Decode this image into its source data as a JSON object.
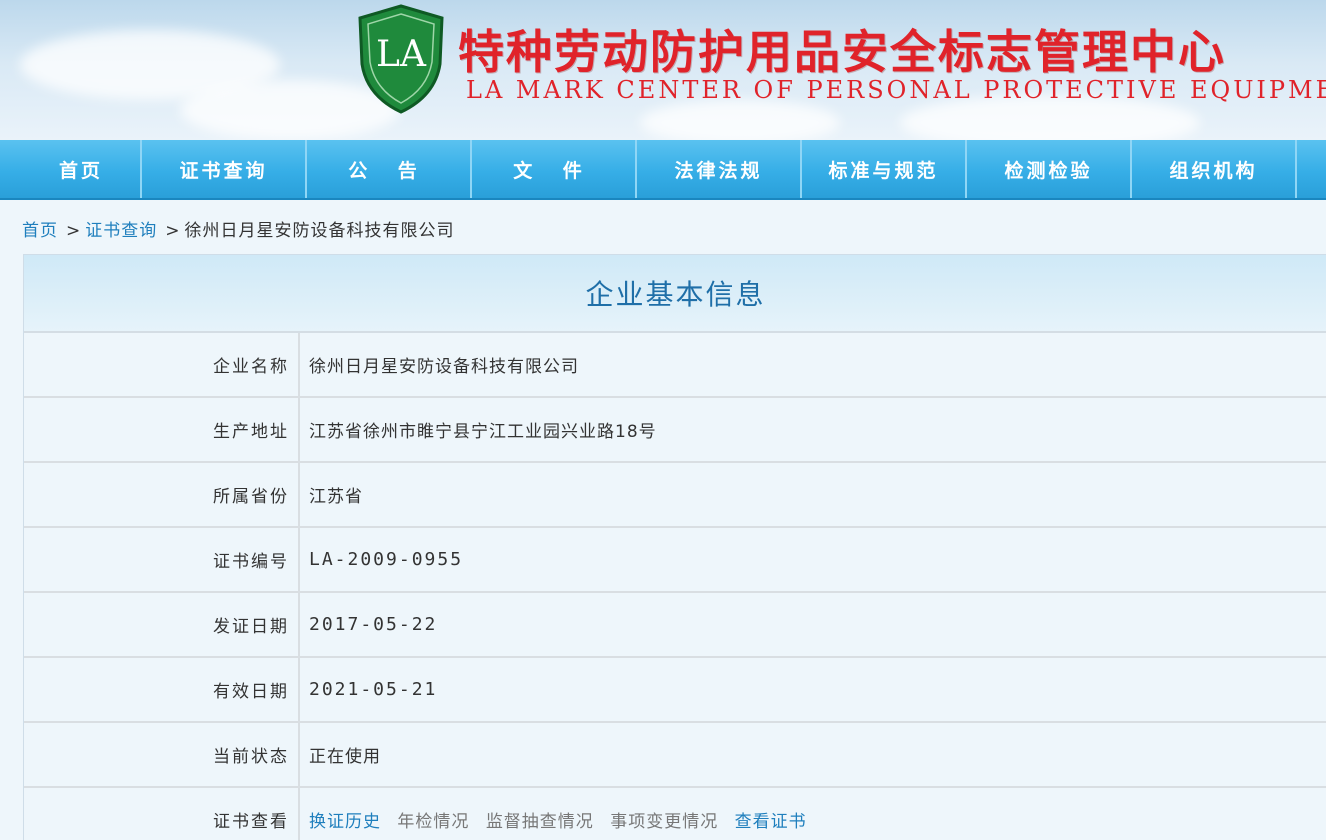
{
  "header": {
    "logo_text": "LA",
    "title_cn": "特种劳动防护用品安全标志管理中心",
    "title_en": "LA MARK CENTER OF PERSONAL PROTECTIVE EQUIPMENT",
    "shield_color": "#1f8a3c",
    "title_color": "#e0232a"
  },
  "nav": {
    "items": [
      "首页",
      "证书查询",
      "公 告",
      "文 件",
      "法律法规",
      "标准与规范",
      "检测检验",
      "组织机构"
    ]
  },
  "breadcrumb": {
    "home": "首页",
    "sep1": ">",
    "cert_query": "证书查询",
    "sep2": ">",
    "current": "徐州日月星安防设备科技有限公司"
  },
  "panel": {
    "title": "企业基本信息",
    "rows": [
      {
        "label": "企业名称",
        "value": "徐州日月星安防设备科技有限公司"
      },
      {
        "label": "生产地址",
        "value": "江苏省徐州市睢宁县宁江工业园兴业路18号"
      },
      {
        "label": "所属省份",
        "value": "江苏省"
      },
      {
        "label": "证书编号",
        "value": "LA-2009-0955"
      },
      {
        "label": "发证日期",
        "value": "2017-05-22"
      },
      {
        "label": "有效日期",
        "value": "2021-05-21"
      },
      {
        "label": "当前状态",
        "value": "正在使用"
      }
    ],
    "cert_view": {
      "label": "证书查看",
      "links": [
        "换证历史",
        "年检情况",
        "监督抽查情况",
        "事项变更情况",
        "查看证书"
      ]
    }
  }
}
